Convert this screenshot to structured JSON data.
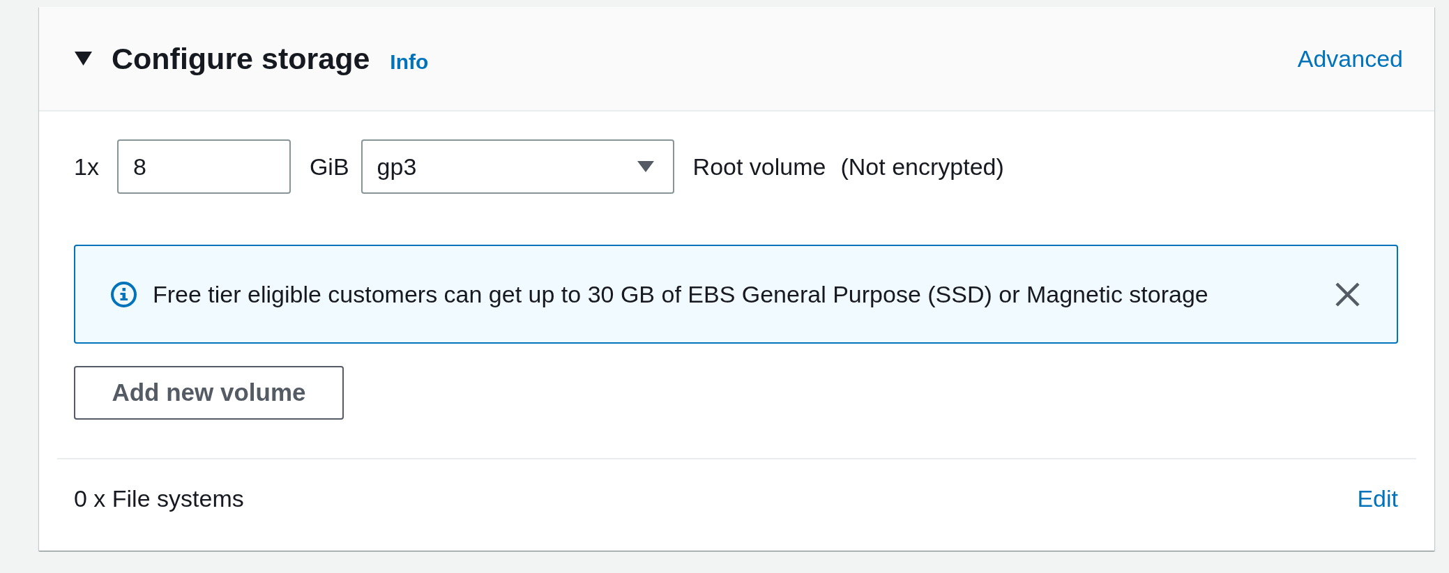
{
  "section": {
    "title": "Configure storage",
    "expanded": true,
    "info_link": "Info",
    "advanced_link": "Advanced"
  },
  "volume": {
    "count": "1x",
    "size": "8",
    "unit": "GiB",
    "type": "gp3",
    "label": "Root volume",
    "encryption": "(Not encrypted)"
  },
  "alert": {
    "kind": "info",
    "message": "Free tier eligible customers can get up to 30 GB of EBS General Purpose (SSD) or Magnetic storage",
    "dismissible": true
  },
  "add_button": "Add new volume",
  "file_systems": {
    "summary": "0 x File systems",
    "edit_link": "Edit"
  }
}
